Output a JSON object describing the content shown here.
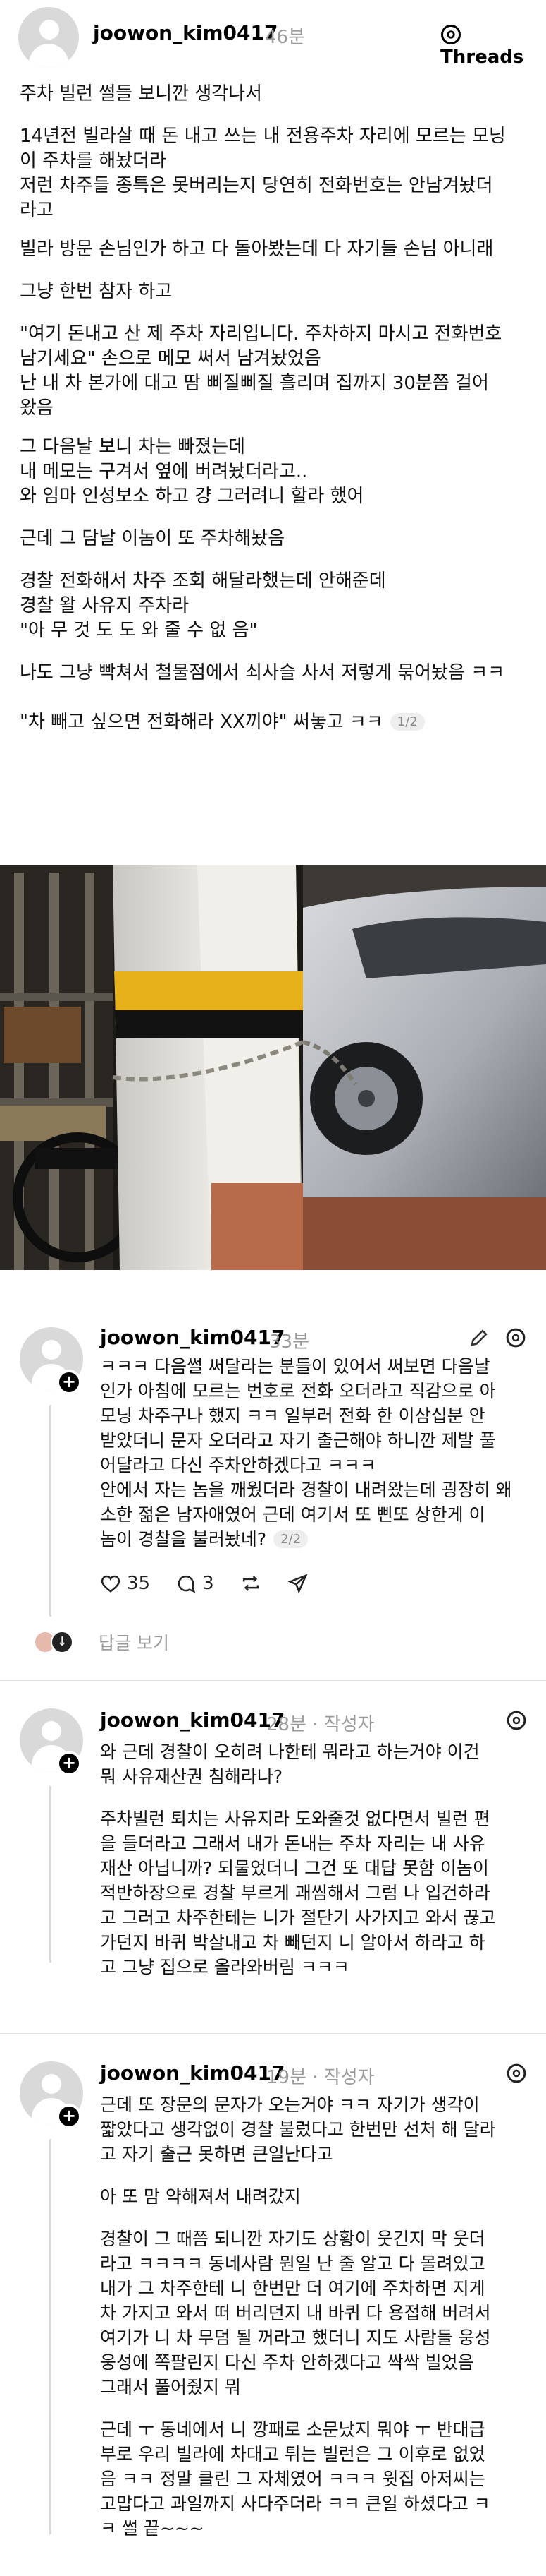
{
  "post": {
    "username": "joowon_kim0417",
    "time": "46분",
    "brand": "Threads",
    "lines": [
      "주차 빌런 썰들 보니깐 생각나서",
      "14년전 빌라살 때 돈 내고 쓰는 내 전용주차 자리에 모르는 모닝",
      "이 주차를 해놨더라",
      "저런 차주들 종특은 못버리는지 당연히 전화번호는 안남겨놨더",
      "라고",
      "빌라 방문 손님인가 하고 다 돌아봤는데 다 자기들 손님 아니래",
      "그냥 한번 참자 하고",
      "\"여기 돈내고 산 제 주차 자리입니다. 주차하지 마시고 전화번호",
      "남기세요\" 손으로 메모 써서 남겨놨었음",
      "난 내 차 본가에 대고 땀 삐질삐질 흘리며 집까지 30분쯤 걸어",
      "왔음",
      "그 다음날 보니 차는 빠졌는데",
      "내 메모는 구겨서 옆에 버려놨더라고..",
      "와 임마 인성보소 하고 걍 그러려니 할라 했어",
      "근데 그 담날 이놈이 또 주차해놨음",
      "경찰 전화해서 차주 조회 해달라했는데 안해준데",
      "경찰 왈 사유지 주차라",
      "\"아 무 것 도 도 와 줄 수 없 음\"",
      "나도 그냥 빡쳐서 철물점에서 쇠사슬 사서 저렇게  묶어놨음 ㅋㅋ",
      "\"차 빼고 싶으면 전화해라 XX끼야\" 써놓고 ㅋㅋ"
    ],
    "pager": "1/2"
  },
  "reply1": {
    "username": "joowon_kim0417",
    "time": "33분",
    "lines": [
      "ㅋㅋㅋ 다음썰 써달라는 분들이 있어서 써보면 다음날",
      "인가 아침에 모르는 번호로 전화 오더라고 직감으로 아",
      "모닝 차주구나 했지 ㅋㅋ 일부러 전화 한 이삼십분 안",
      "받았더니 문자 오더라고 자기 출근해야 하니깐 제발 풀",
      "어달라고 다신 주차안하겠다고 ㅋㅋㅋ",
      "드디어 왔구나 하고 차 있는 곳에 갔더니 왠 젊은 남자",
      "가 있더라고 근데 그 사이에 경찰 불렀더라 ㅋㅋ 전화",
      "할 때 출근 어쩌구 하더니 실은 경찰이 마침 그때 와서",
      "안에서 자는 놈을 깨웠더라 경찰이 내려왔는데 굉장히 왜",
      "소한 젊은 남자애였어 근데 여기서 또 삔또 상한게 이",
      "놈이 경찰을 불러놨네?"
    ],
    "pager": "2/2",
    "likes": "35",
    "comments": "3",
    "view_replies": "답글 보기"
  },
  "reply2": {
    "username": "joowon_kim0417",
    "time": "28분",
    "author_tag": "작성자",
    "lines": [
      "와 근데 경찰이 오히려 나한테 뭐라고 하는거야 이건",
      "뭐 사유재산권 침해라나?",
      "주차빌런 퇴치는 사유지라 도와줄것 없다면서 빌런 편",
      "을 들더라고 그래서 내가 돈내는 주차 자리는 내 사유",
      "재산 아닙니까? 되물었더니 그건 또 대답 못함 이놈이",
      "적반하장으로 경찰 부르게 괘씸해서 그럼 나 입건하라",
      "고 그러고 차주한테는 니가 절단기 사가지고 와서 끊고",
      "가던지 바퀴 박살내고 차 빼던지 니 알아서 하라고 하",
      "고 그냥 집으로 올라와버림 ㅋㅋㅋ"
    ]
  },
  "reply3": {
    "username": "joowon_kim0417",
    "time": "19분",
    "author_tag": "작성자",
    "lines": [
      "근데 또 장문의 문자가 오는거야 ㅋㅋ 자기가 생각이",
      "짧았다고 생각없이 경찰 불렀다고 한번만 선처 해 달라",
      "고 자기 출근 못하면 큰일난다고",
      "아 또 맘 약해져서 내려갔지",
      "경찰이 그 때쯤 되니깐 자기도 상황이 웃긴지 막 웃더",
      "라고 ㅋㅋㅋㅋ 동네사람 뭔일 난 줄 알고 다 몰려있고",
      "내가 그 차주한테 니 한번만 더 여기에 주차하면 지게",
      "차 가지고 와서 떠 버리던지 내 바퀴 다 용접해 버려서",
      "여기가 니 차 무덤 될 꺼라고 했더니 지도 사람들 웅성",
      "웅성에 쪽팔린지 다신 주차 안하겠다고 싹싹 빌었음",
      "그래서 풀어줬지 뭐",
      "근데 ㅜ 동네에서 니 깡패로 소문났지 뭐야 ㅜ 반대급",
      "부로 우리 빌라에 차대고 튀는 빌런은 그 이후로 없었",
      "음 ㅋㅋ 정말 클린 그 자체였어 ㅋㅋㅋ 윗집 아저씨는",
      "고맙다고 과일까지 사다주더라 ㅋㅋ 큰일 하셨다고 ㅋ",
      "ㅋ 썰 끝~~~"
    ]
  }
}
